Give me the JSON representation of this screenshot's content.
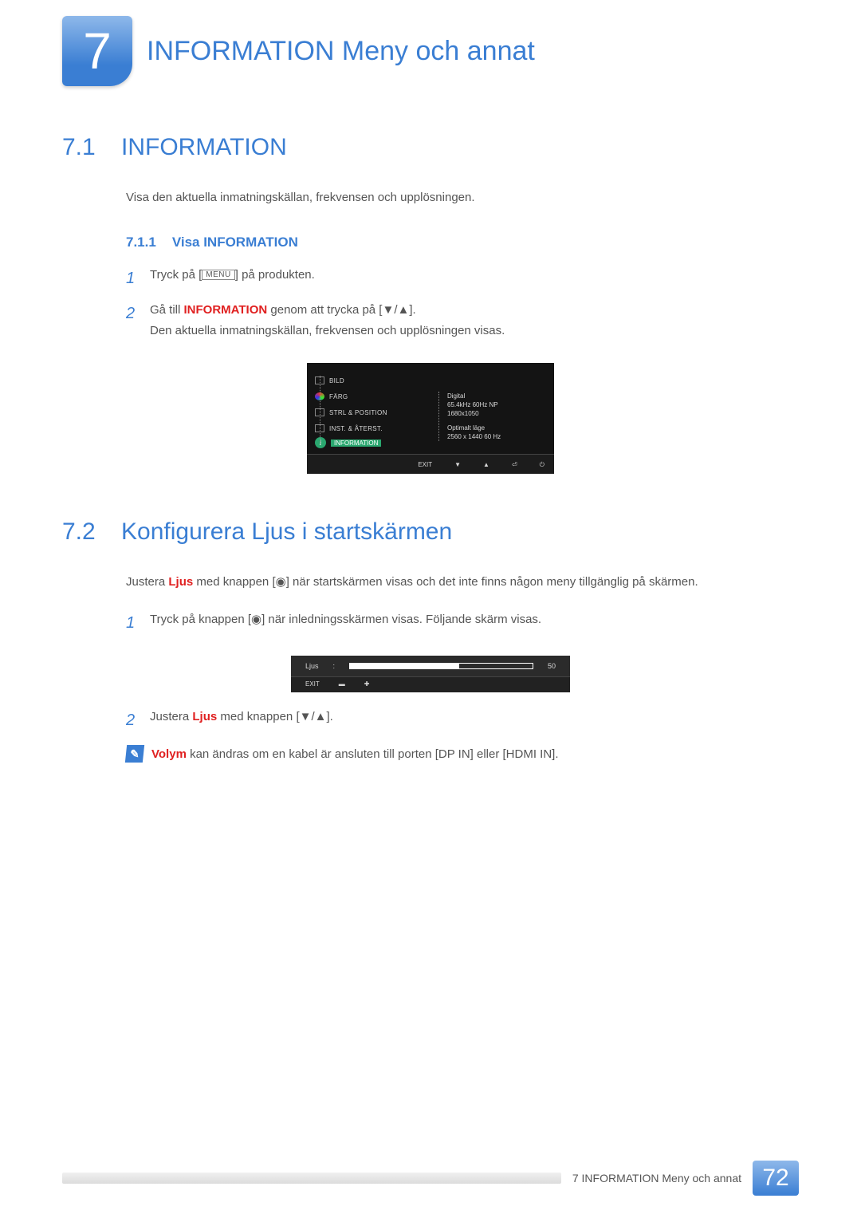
{
  "chapter": {
    "number": "7",
    "title": "INFORMATION Meny och annat"
  },
  "s71": {
    "num": "7.1",
    "title": "INFORMATION",
    "intro": "Visa den aktuella inmatningskällan, frekvensen och upplösningen.",
    "sub": {
      "num": "7.1.1",
      "title": "Visa INFORMATION"
    },
    "step1": {
      "num": "1",
      "pre": "Tryck på [",
      "key": "MENU",
      "post": "] på produkten."
    },
    "step2": {
      "num": "2",
      "pre": "Gå till ",
      "red": "INFORMATION",
      "post": " genom att trycka på [▼/▲].",
      "line2": "Den aktuella inmatningskällan, frekvensen och upplösningen visas."
    }
  },
  "osd": {
    "items": [
      "BILD",
      "FÄRG",
      "STRL & POSITION",
      "INST. & ÅTERST."
    ],
    "info_label": "INFORMATION",
    "right": {
      "l1": "Digital",
      "l2": "65.4kHz 60Hz NP",
      "l3": "1680x1050",
      "l4": "Optimalt läge",
      "l5": "2560 x 1440  60 Hz"
    },
    "bar": {
      "exit": "EXIT",
      "down": "▼",
      "up": "▲",
      "enter": "⏎",
      "power": "⏻"
    }
  },
  "s72": {
    "num": "7.2",
    "title": "Konfigurera Ljus i startskärmen",
    "intro_pre": "Justera ",
    "intro_red": "Ljus",
    "intro_post": " med knappen [◉] när startskärmen visas och det inte finns någon meny tillgänglig på skärmen.",
    "step1": {
      "num": "1",
      "text": "Tryck på knappen [◉] när inledningsskärmen visas. Följande skärm visas."
    },
    "step2": {
      "num": "2",
      "pre": "Justera ",
      "red": "Ljus",
      "post": " med knappen [▼/▲]."
    }
  },
  "ljus": {
    "label": "Ljus",
    "colon": ":",
    "value": "50",
    "exit": "EXIT",
    "minus": "▬",
    "plus": "✚"
  },
  "note": {
    "red": "Volym",
    "rest": " kan ändras om en kabel är ansluten till porten [DP IN] eller [HDMI IN]."
  },
  "footer": {
    "text": "7 INFORMATION Meny och annat",
    "page": "72"
  }
}
